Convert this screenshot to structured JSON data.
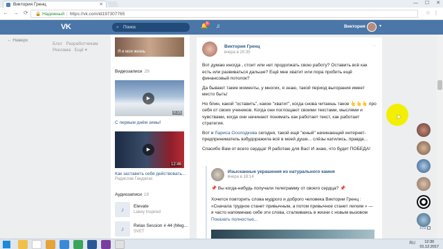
{
  "browser": {
    "tab_title": "Виктория Гренц",
    "tab_close": "✕",
    "window_buttons": [
      "—",
      "☐",
      "✕"
    ],
    "nav_icons": [
      "←",
      "→",
      "⟳"
    ],
    "security_label": "Надежный",
    "url": "https://vk.com/id197307765",
    "star_icon": "☆",
    "menu_icon": "⋮"
  },
  "vk_header": {
    "logo": "VK",
    "search_placeholder": "Поиск",
    "search_icon": "🔍",
    "bell_icon": "🔔",
    "notif_count": "5",
    "music_icon": "♫",
    "user_name": "Виктория",
    "caret": "▾"
  },
  "left_nav": {
    "back": "← Наверх",
    "links": [
      "Блог",
      "Разработчикам",
      "Реклама",
      "Ещё ▾"
    ]
  },
  "profile_column": {
    "top_photo_caption": "Я и моя жизнь",
    "videos_title": "Видеозаписи",
    "videos_count": "29",
    "videos": [
      {
        "title": "С первым днём зимы!",
        "duration": "0:15"
      },
      {
        "title": "Как заставить себя действовать...",
        "duration": "12:46",
        "author": "Радислав Гандапас"
      }
    ],
    "audio_title": "Аудиозаписи",
    "audio_count": "18",
    "tracks": [
      {
        "title": "Elevate",
        "artist": "Lakey Inspired"
      },
      {
        "title": "Relax Session # 44 (Meg...",
        "artist": "SVET"
      }
    ],
    "note_icon": "♪"
  },
  "post": {
    "author": "Виктория Гренц",
    "time": "вчера в 20:35",
    "more_icon": "···",
    "paragraphs": [
      "Вот думаю иногда , стоит или нет продолжать свою работу? Оставить всё как есть или развиваться дальше? Ещё мне хватит или пора пробить ещё финансовый потолок?",
      "Да бывают такие моменты, у многих, я знаю, такой период выгорания имеет место быть!",
      "Но блин, какой \"оставить\", какое \"хватит\", когда снова читаешь такое 👆👆👆 про себя от своих учеников. Когда они поглощают своими текстами, мыслями и чувствами, когда они начинают понимать как работает текст, как работает стратегия."
    ],
    "p4_before": "Вот и ",
    "p4_link": "Лариса Осолодкова",
    "p4_after": " сегодня, такой ещё \"юный\" начинающий интернет-предприниматель взбудоражила всё в моей душе... слёзы катились, правда...",
    "p5": "Спасибо Вам от всего сердца! Я работаю для Вас! И знаю, что будет ПОБЕДА!",
    "repost": {
      "author": "Изысканные украшения из натурального камня",
      "time": "вчера в 18:14",
      "line1": "📌 Вы когда-нибудь получали телеграмму от своего сердца? 📌",
      "line2": "Хочется повторить слова мудрого и доброго человека Виктории Гренц : «Сначала трудное станет привычным, а потом привычное станет легким » — я часто напоминаю себе эти слова, сталкиваясь в жизни с новым вызовом",
      "more": "Показать полностью..."
    }
  },
  "right_rail": {
    "friends_count": "102"
  },
  "cursor_arrow": "➤",
  "taskbar": {
    "tray": "RU",
    "time": "12:30",
    "date": "01.12.2017"
  }
}
